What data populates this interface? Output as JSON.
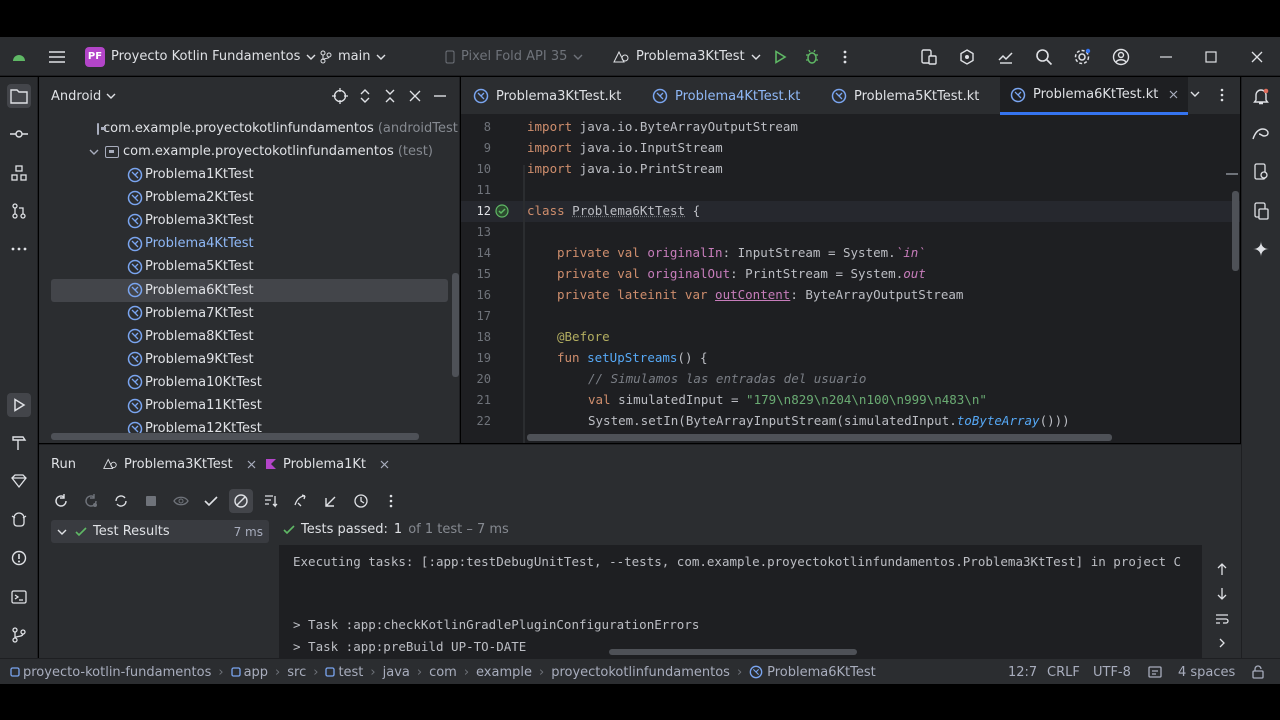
{
  "titlebar": {
    "project_badge": "PF",
    "project_name": "Proyecto Kotlin Fundamentos",
    "branch": "main",
    "device": "Pixel Fold API 35",
    "run_config": "Problema3KtTest"
  },
  "project_panel": {
    "view_mode": "Android",
    "tree": [
      {
        "label": "com.example.proyectokotlinfundamentos",
        "suffix": "(androidTest)"
      },
      {
        "label": "com.example.proyectokotlinfundamentos",
        "suffix": "(test)"
      },
      {
        "label": "Problema1KtTest"
      },
      {
        "label": "Problema2KtTest"
      },
      {
        "label": "Problema3KtTest"
      },
      {
        "label": "Problema4KtTest"
      },
      {
        "label": "Problema5KtTest"
      },
      {
        "label": "Problema6KtTest"
      },
      {
        "label": "Problema7KtTest"
      },
      {
        "label": "Problema8KtTest"
      },
      {
        "label": "Problema9KtTest"
      },
      {
        "label": "Problema10KtTest"
      },
      {
        "label": "Problema11KtTest"
      },
      {
        "label": "Problema12KtTest"
      }
    ]
  },
  "editor": {
    "tabs": [
      {
        "label": "Problema3KtTest.kt"
      },
      {
        "label": "Problema4KtTest.kt"
      },
      {
        "label": "Problema5KtTest.kt"
      },
      {
        "label": "Problema6KtTest.kt"
      }
    ],
    "line_numbers": [
      "8",
      "9",
      "10",
      "11",
      "12",
      "13",
      "14",
      "15",
      "16",
      "17",
      "18",
      "19",
      "20",
      "21",
      "22"
    ],
    "code": {
      "l8": {
        "kw": "import",
        "rest": " java.io.ByteArrayOutputStream"
      },
      "l9": {
        "kw": "import",
        "rest": " java.io.InputStream"
      },
      "l10": {
        "kw": "import",
        "rest": " java.io.PrintStream"
      },
      "l12": {
        "kw": "class",
        "name": "Problema6KtTest",
        "rest": " {"
      },
      "l14": {
        "kw": "private val",
        "name": "originalIn",
        "rest": ": InputStream = System.",
        "tail": "`in`"
      },
      "l15": {
        "kw": "private val",
        "name": "originalOut",
        "rest": ": PrintStream = System.",
        "tail": "out"
      },
      "l16": {
        "kw": "private lateinit var",
        "name": "outContent",
        "rest": ": ByteArrayOutputStream"
      },
      "l18": {
        "ann": "@Before"
      },
      "l19": {
        "kw": "fun",
        "name": "setUpStreams",
        "rest": "() {"
      },
      "l20": {
        "cmt": "// Simulamos las entradas del usuario"
      },
      "l21": {
        "kw": "val",
        "name": "simulatedInput",
        "rest": " = ",
        "str": "\"179\\n829\\n204\\n100\\n999\\n483\\n\""
      },
      "l22": {
        "pre": "System.setIn(ByteArrayInputStream(simulatedInput.",
        "ext": "toByteArray",
        "post": "()))"
      }
    }
  },
  "run_panel": {
    "title": "Run",
    "tabs": [
      {
        "label": "Problema3KtTest"
      },
      {
        "label": "Problema1Kt"
      }
    ],
    "results_label": "Test Results",
    "results_time": "7 ms",
    "tests_passed_label": "Tests passed:",
    "tests_passed_count": "1",
    "tests_passed_rest": "of 1 test – 7 ms",
    "console": [
      "Executing tasks: [:app:testDebugUnitTest, --tests, com.example.proyectokotlinfundamentos.Problema3KtTest] in project C",
      "",
      "",
      "> Task :app:checkKotlinGradlePluginConfigurationErrors",
      "> Task :app:preBuild UP-TO-DATE"
    ]
  },
  "statusbar": {
    "breadcrumb": [
      "proyecto-kotlin-fundamentos",
      "app",
      "src",
      "test",
      "java",
      "com",
      "example",
      "proyectokotlinfundamentos",
      "Problema6KtTest"
    ],
    "position": "12:7",
    "line_sep": "CRLF",
    "encoding": "UTF-8",
    "indent": "4 spaces"
  },
  "colors": {
    "accent": "#3574f0",
    "success": "#5fb865",
    "badge": "#b345c9"
  }
}
